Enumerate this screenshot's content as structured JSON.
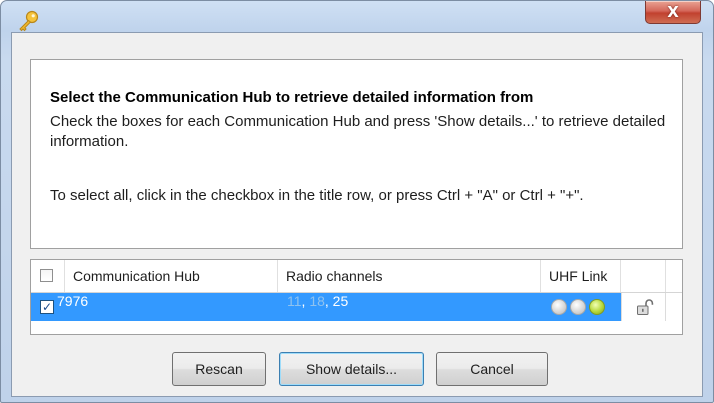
{
  "window": {
    "close_label": "X",
    "icon": "key-icon"
  },
  "info": {
    "heading": "Select the Communication Hub to retrieve detailed information from",
    "description": "Check the boxes for each Communication Hub and press 'Show details...' to retrieve detailed information.",
    "hint": "To select all, click in the checkbox in the title row, or press Ctrl + \"A\" or Ctrl + \"+\"."
  },
  "table": {
    "columns": [
      "Communication Hub",
      "Radio channels",
      "UHF Link"
    ],
    "select_all_checked": false,
    "rows": [
      {
        "checked": true,
        "hub": "7976",
        "radio_channels_faded": [
          "11",
          "18"
        ],
        "radio_channels_text": ", 25",
        "uhf_leds": [
          "off",
          "off",
          "on"
        ],
        "lock_icon": "unlocked-padlock-icon",
        "selected": true
      }
    ]
  },
  "buttons": {
    "rescan": "Rescan",
    "show_details": "Show details...",
    "cancel": "Cancel"
  },
  "colors": {
    "selection": "#3399ff",
    "led_on": "#b6d83a",
    "led_off": "#d4d4d4",
    "close_button": "#c1412f"
  }
}
